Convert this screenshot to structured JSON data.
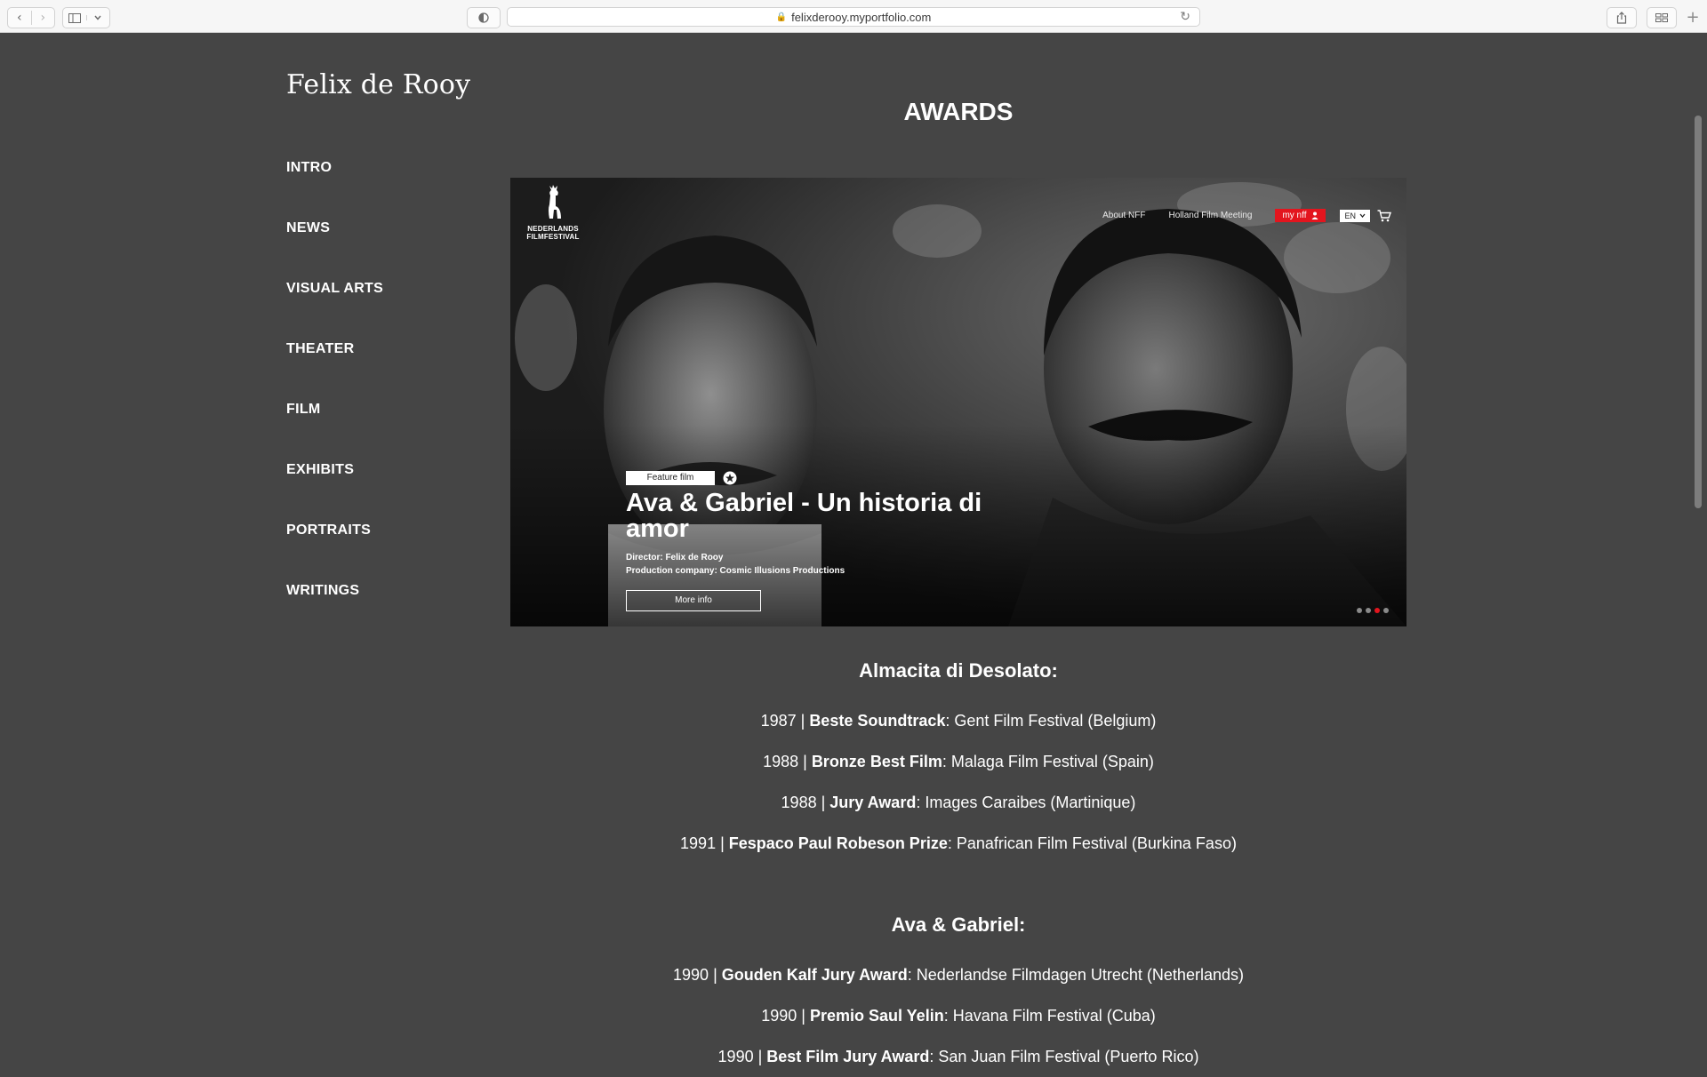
{
  "browser": {
    "url": "felixderooy.myportfolio.com"
  },
  "site": {
    "title": "Felix de Rooy",
    "menu": [
      "INTRO",
      "NEWS",
      "VISUAL ARTS",
      "THEATER",
      "FILM",
      "EXHIBITS",
      "PORTRAITS",
      "WRITINGS"
    ]
  },
  "page": {
    "heading": "AWARDS"
  },
  "banner": {
    "logo_text_line1": "NEDERLANDS",
    "logo_text_line2": "FILMFESTIVAL",
    "nav_about": "About NFF",
    "nav_meeting": "Holland Film Meeting",
    "nav_mynff": "my nff",
    "nav_lang": "EN",
    "tag": "Feature film",
    "film_title": "Ava & Gabriel - Un historia di amor",
    "director": "Director: Felix de Rooy",
    "production": "Production company: Cosmic Illusions Productions",
    "more_info": "More info",
    "accent_color": "#e3151e",
    "slides_total": 4,
    "active_slide": 3
  },
  "awards": [
    {
      "heading": "Almacita di Desolato:",
      "items": [
        {
          "year": "1987",
          "sep": " | ",
          "award": "Beste Soundtrack",
          "festival": ": Gent Film Festival (Belgium)"
        },
        {
          "year": "1988",
          "sep": " | ",
          "award": "Bronze Best Film",
          "festival": ": Malaga Film Festival (Spain)"
        },
        {
          "year": "1988",
          "sep": " | ",
          "award": "Jury Award",
          "festival": ": Images Caraibes (Martinique)"
        },
        {
          "year": "1991",
          "sep": " | ",
          "award": "Fespaco Paul Robeson Prize",
          "festival": ": Panafrican Film Festival (Burkina Faso)"
        }
      ]
    },
    {
      "heading": "Ava & Gabriel:",
      "items": [
        {
          "year": "1990",
          "sep": " | ",
          "award": "Gouden Kalf Jury Award",
          "festival": ": Nederlandse Filmdagen Utrecht (Netherlands)"
        },
        {
          "year": "1990",
          "sep": " | ",
          "award": "Premio Saul Yelin",
          "festival": ": Havana Film Festival (Cuba)"
        },
        {
          "year": "1990",
          "sep": " | ",
          "award": "Best Film Jury Award",
          "festival": ": San Juan Film Festival (Puerto Rico)"
        }
      ]
    }
  ],
  "theme": {
    "page_bg": "#454545",
    "text": "#ffffff"
  }
}
